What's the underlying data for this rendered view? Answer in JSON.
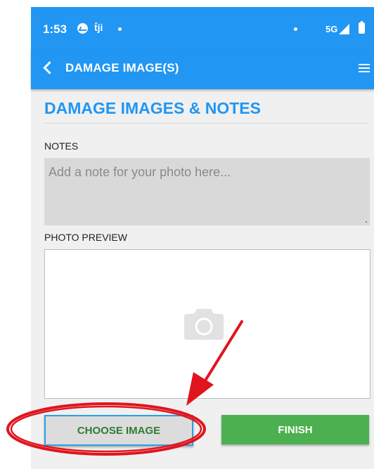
{
  "status_bar": {
    "time": "1:53",
    "network": "5G",
    "icons": [
      "messenger-icon",
      "teams-icon",
      "notification-dot-icon",
      "signal-icon",
      "battery-icon"
    ]
  },
  "app_bar": {
    "title": "DAMAGE IMAGE(S)",
    "back_icon": "chevron-left-icon",
    "menu_icon": "hamburger-menu-icon",
    "teams_glyph": "ṫ́ji"
  },
  "page": {
    "heading": "DAMAGE IMAGES & NOTES",
    "notes_label": "NOTES",
    "notes_placeholder": "Add a note for your photo here...",
    "notes_value": "",
    "photo_preview_label": "PHOTO PREVIEW",
    "preview_icon": "camera-icon"
  },
  "actions": {
    "choose_image_label": "CHOOSE IMAGE",
    "finish_label": "FINISH"
  },
  "colors": {
    "primary": "#2196f3",
    "finish_green": "#4caf50",
    "choose_text_green": "#2e7d32",
    "annotation_red": "#e0141e"
  }
}
